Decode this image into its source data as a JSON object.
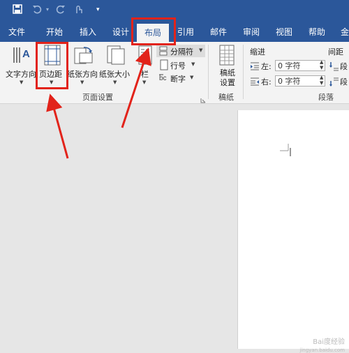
{
  "qat": {
    "save_icon": "save-icon",
    "undo_icon": "undo-icon",
    "redo_icon": "redo-icon",
    "touch_icon": "touch-icon",
    "customize_icon": "customize-icon"
  },
  "tabs": [
    "文件",
    "开始",
    "插入",
    "设计",
    "布局",
    "引用",
    "邮件",
    "审阅",
    "视图",
    "帮助",
    "金"
  ],
  "active_tab": "布局",
  "page_setup": {
    "text_direction": "文字方向",
    "margins": "页边距",
    "orientation": "纸张方向",
    "size": "纸张大小",
    "columns": "栏",
    "breaks": "分隔符",
    "line_numbers": "行号",
    "hyphenation": "断字",
    "group_label": "页面设置"
  },
  "manuscript": {
    "button": "稿纸设置",
    "group_label": "稿纸"
  },
  "paragraph": {
    "indent_title": "缩进",
    "spacing_title": "间距",
    "left_label": "左:",
    "right_label": "右:",
    "left_value": "0 字符",
    "right_value": "0 字符",
    "before_label": "段",
    "after_label": "段",
    "group_label": "段落"
  },
  "watermark": {
    "brand": "Bai度经验",
    "url": "jingyan.baidu.com"
  },
  "colors": {
    "brand": "#2b579a",
    "annotation": "#e2231a"
  }
}
